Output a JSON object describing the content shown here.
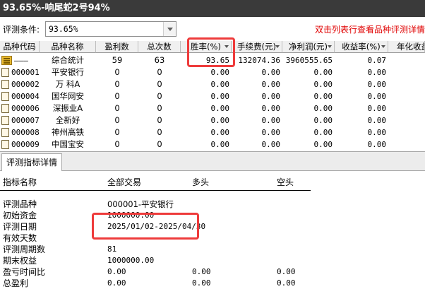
{
  "window": {
    "title": "93.65%-响尾蛇2号94%"
  },
  "condition": {
    "label": "评测条件:",
    "value": "93.65%",
    "hint": "双击列表行查看品种评测详情"
  },
  "grid": {
    "headers": [
      "品种代码",
      "品种名称",
      "盈利数",
      "总次数",
      "胜率(%)",
      "手续费(元)",
      "净利润(元)",
      "收益率(%)",
      "年化收益率(%)"
    ],
    "rows": [
      {
        "icon": "summary-icon",
        "code": "———",
        "name": "综合统计",
        "wins": "59",
        "total": "63",
        "winrate": "93.65",
        "fee": "132074.36",
        "profit": "3960555.65",
        "return": "0.07"
      },
      {
        "icon": "doc-icon",
        "code": "000001",
        "name": "平安银行",
        "wins": "0",
        "total": "0",
        "winrate": "0.00",
        "fee": "0.00",
        "profit": "0.00",
        "return": "0.00"
      },
      {
        "icon": "doc-icon",
        "code": "000002",
        "name": "万 科A",
        "wins": "0",
        "total": "0",
        "winrate": "0.00",
        "fee": "0.00",
        "profit": "0.00",
        "return": "0.00"
      },
      {
        "icon": "doc-icon",
        "code": "000004",
        "name": "国华网安",
        "wins": "0",
        "total": "0",
        "winrate": "0.00",
        "fee": "0.00",
        "profit": "0.00",
        "return": "0.00"
      },
      {
        "icon": "doc-icon",
        "code": "000006",
        "name": "深振业A",
        "wins": "0",
        "total": "0",
        "winrate": "0.00",
        "fee": "0.00",
        "profit": "0.00",
        "return": "0.00"
      },
      {
        "icon": "doc-icon",
        "code": "000007",
        "name": "全新好",
        "wins": "0",
        "total": "0",
        "winrate": "0.00",
        "fee": "0.00",
        "profit": "0.00",
        "return": "0.00"
      },
      {
        "icon": "doc-icon",
        "code": "000008",
        "name": "神州高铁",
        "wins": "0",
        "total": "0",
        "winrate": "0.00",
        "fee": "0.00",
        "profit": "0.00",
        "return": "0.00"
      },
      {
        "icon": "doc-icon",
        "code": "000009",
        "name": "中国宝安",
        "wins": "0",
        "total": "0",
        "winrate": "0.00",
        "fee": "0.00",
        "profit": "0.00",
        "return": "0.00"
      }
    ]
  },
  "tabs": [
    "评测指标详情"
  ],
  "detail": {
    "headers": [
      "指标名称",
      "全部交易",
      "多头",
      "空头"
    ],
    "rows": [
      {
        "label": "评测品种",
        "all": "000001-平安银行",
        "long": "",
        "short": ""
      },
      {
        "label": "初始资金",
        "all": "1000000.00",
        "long": "",
        "short": ""
      },
      {
        "label": "评测日期",
        "all": "2025/01/02-2025/04/30",
        "long": "",
        "short": ""
      },
      {
        "label": "有效天数",
        "all": "",
        "long": "",
        "short": ""
      },
      {
        "label": "评测周期数",
        "all": "81",
        "long": "",
        "short": ""
      },
      {
        "label": "期末权益",
        "all": "1000000.00",
        "long": "",
        "short": ""
      },
      {
        "label": "盈亏时间比",
        "all": "0.00",
        "long": "0.00",
        "short": "0.00"
      },
      {
        "label": "总盈利",
        "all": "0.00",
        "long": "0.00",
        "short": "0.00"
      }
    ]
  },
  "colors": {
    "highlight": "#ee3b3b",
    "hint": "#e00000",
    "titlebar": "#3a3a3a"
  }
}
